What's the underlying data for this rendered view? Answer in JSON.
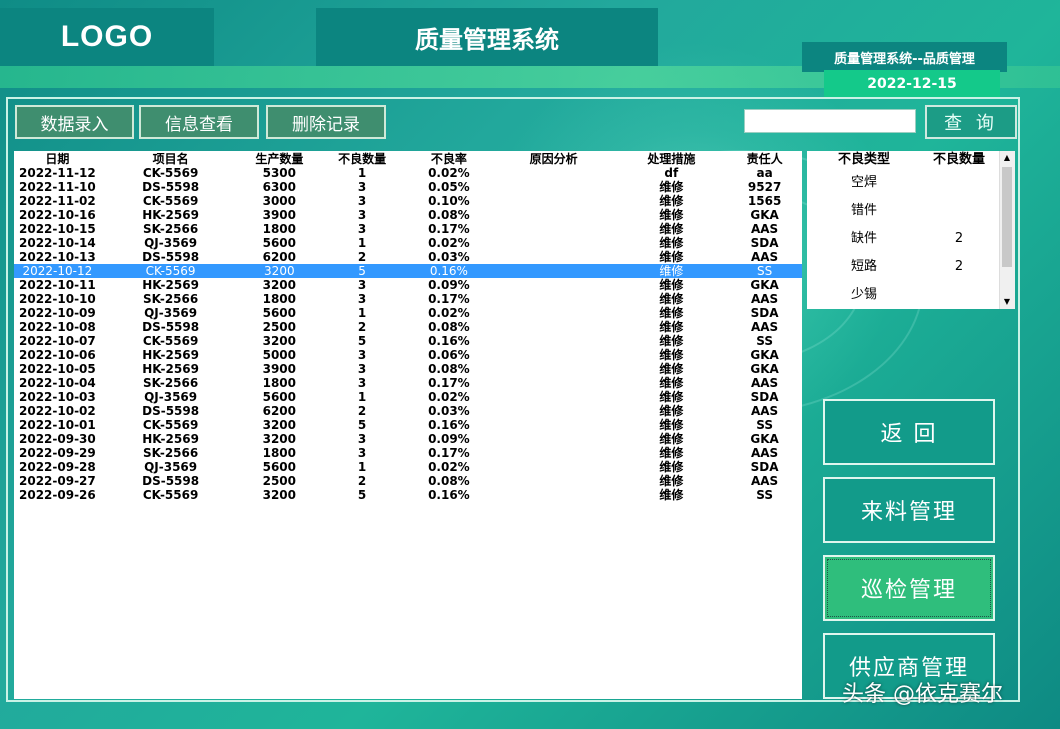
{
  "header": {
    "logo": "LOGO",
    "title": "质量管理系统",
    "subsystem": "质量管理系统--品质管理",
    "date": "2022-12-15"
  },
  "toolbar": {
    "entry_label": "数据录入",
    "view_label": "信息查看",
    "delete_label": "删除记录",
    "search_value": "",
    "query_label": "查 询"
  },
  "table": {
    "columns": [
      "日期",
      "项目名",
      "生产数量",
      "不良数量",
      "不良率",
      "原因分析",
      "处理措施",
      "责任人"
    ],
    "rows": [
      [
        "2022-11-12",
        "CK-5569",
        "5300",
        "1",
        "0.02%",
        "",
        "df",
        "aa"
      ],
      [
        "2022-11-10",
        "DS-5598",
        "6300",
        "3",
        "0.05%",
        "",
        "维修",
        "9527"
      ],
      [
        "2022-11-02",
        "CK-5569",
        "3000",
        "3",
        "0.10%",
        "",
        "维修",
        "1565"
      ],
      [
        "2022-10-16",
        "HK-2569",
        "3900",
        "3",
        "0.08%",
        "",
        "维修",
        "GKA"
      ],
      [
        "2022-10-15",
        "SK-2566",
        "1800",
        "3",
        "0.17%",
        "",
        "维修",
        "AAS"
      ],
      [
        "2022-10-14",
        "QJ-3569",
        "5600",
        "1",
        "0.02%",
        "",
        "维修",
        "SDA"
      ],
      [
        "2022-10-13",
        "DS-5598",
        "6200",
        "2",
        "0.03%",
        "",
        "维修",
        "AAS"
      ],
      [
        "2022-10-12",
        "CK-5569",
        "3200",
        "5",
        "0.16%",
        "",
        "维修",
        "SS"
      ],
      [
        "2022-10-11",
        "HK-2569",
        "3200",
        "3",
        "0.09%",
        "",
        "维修",
        "GKA"
      ],
      [
        "2022-10-10",
        "SK-2566",
        "1800",
        "3",
        "0.17%",
        "",
        "维修",
        "AAS"
      ],
      [
        "2022-10-09",
        "QJ-3569",
        "5600",
        "1",
        "0.02%",
        "",
        "维修",
        "SDA"
      ],
      [
        "2022-10-08",
        "DS-5598",
        "2500",
        "2",
        "0.08%",
        "",
        "维修",
        "AAS"
      ],
      [
        "2022-10-07",
        "CK-5569",
        "3200",
        "5",
        "0.16%",
        "",
        "维修",
        "SS"
      ],
      [
        "2022-10-06",
        "HK-2569",
        "5000",
        "3",
        "0.06%",
        "",
        "维修",
        "GKA"
      ],
      [
        "2022-10-05",
        "HK-2569",
        "3900",
        "3",
        "0.08%",
        "",
        "维修",
        "GKA"
      ],
      [
        "2022-10-04",
        "SK-2566",
        "1800",
        "3",
        "0.17%",
        "",
        "维修",
        "AAS"
      ],
      [
        "2022-10-03",
        "QJ-3569",
        "5600",
        "1",
        "0.02%",
        "",
        "维修",
        "SDA"
      ],
      [
        "2022-10-02",
        "DS-5598",
        "6200",
        "2",
        "0.03%",
        "",
        "维修",
        "AAS"
      ],
      [
        "2022-10-01",
        "CK-5569",
        "3200",
        "5",
        "0.16%",
        "",
        "维修",
        "SS"
      ],
      [
        "2022-09-30",
        "HK-2569",
        "3200",
        "3",
        "0.09%",
        "",
        "维修",
        "GKA"
      ],
      [
        "2022-09-29",
        "SK-2566",
        "1800",
        "3",
        "0.17%",
        "",
        "维修",
        "AAS"
      ],
      [
        "2022-09-28",
        "QJ-3569",
        "5600",
        "1",
        "0.02%",
        "",
        "维修",
        "SDA"
      ],
      [
        "2022-09-27",
        "DS-5598",
        "2500",
        "2",
        "0.08%",
        "",
        "维修",
        "AAS"
      ],
      [
        "2022-09-26",
        "CK-5569",
        "3200",
        "5",
        "0.16%",
        "",
        "维修",
        "SS"
      ]
    ],
    "selected_index": 7
  },
  "defects": {
    "columns": [
      "不良类型",
      "不良数量"
    ],
    "rows": [
      [
        "空焊",
        ""
      ],
      [
        "错件",
        ""
      ],
      [
        "缺件",
        "2"
      ],
      [
        "短路",
        "2"
      ],
      [
        "少锡",
        ""
      ]
    ]
  },
  "nav": {
    "back": "返 回",
    "incoming": "来料管理",
    "patrol": "巡检管理",
    "supplier": "供应商管理"
  },
  "watermark": "头条 @依克赛尔",
  "colors": {
    "accent": "#0c8580",
    "selection": "#3399ff",
    "active_nav": "#2fbe7c"
  }
}
